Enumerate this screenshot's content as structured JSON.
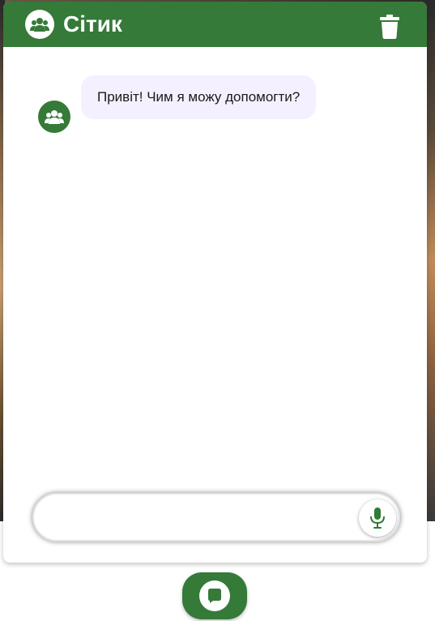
{
  "header": {
    "title": "Сітик",
    "logo_icon": "bot-team-icon",
    "delete_icon": "trash-icon"
  },
  "messages": [
    {
      "sender": "bot",
      "avatar_icon": "bot-team-icon",
      "text": "Привіт! Чим я можу допомогти?"
    }
  ],
  "composer": {
    "value": "",
    "placeholder": "",
    "mic_icon": "microphone-icon"
  },
  "launcher": {
    "icon": "chat-bubble-icon"
  },
  "colors": {
    "primary": "#357a38",
    "bubble_bg": "#f4f0ff",
    "mic_accent": "#2e7d32"
  }
}
